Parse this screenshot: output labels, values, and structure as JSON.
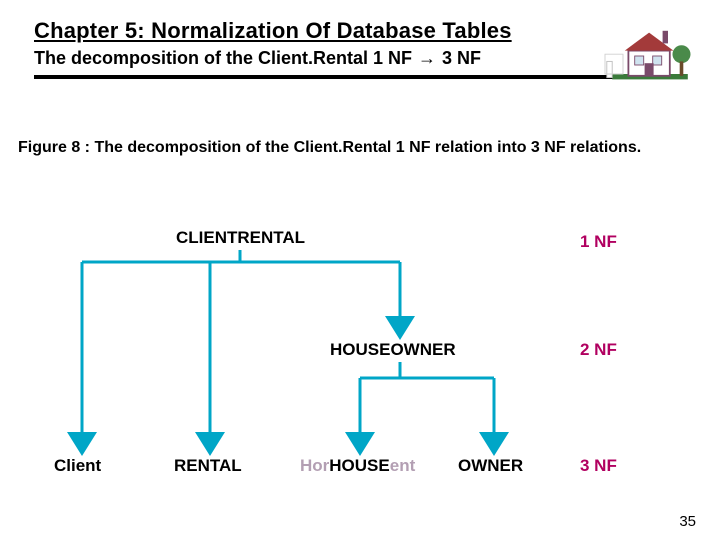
{
  "header": {
    "chapter_title": "Chapter 5: Normalization Of Database Tables",
    "subtitle_prefix": "The decomposition of the Client.Rental 1 NF",
    "subtitle_arrow": "→",
    "subtitle_suffix": "3 NF"
  },
  "caption": "Figure 8 : The decomposition of the Client.Rental 1 NF relation into 3 NF relations.",
  "nodes": {
    "root": "CLIENTRENTAL",
    "mid": "HOUSEOWNER",
    "leaf_client": "Client",
    "leaf_rental": "RENTAL",
    "leaf_house_bg_left": "Hor",
    "leaf_house": "HOUSE",
    "leaf_house_bg_right": "ent",
    "leaf_owner": "OWNER"
  },
  "nf_labels": {
    "l1": "1 NF",
    "l2": "2 NF",
    "l3": "3 NF"
  },
  "page_number": "35",
  "icon": {
    "name": "house-icon"
  }
}
